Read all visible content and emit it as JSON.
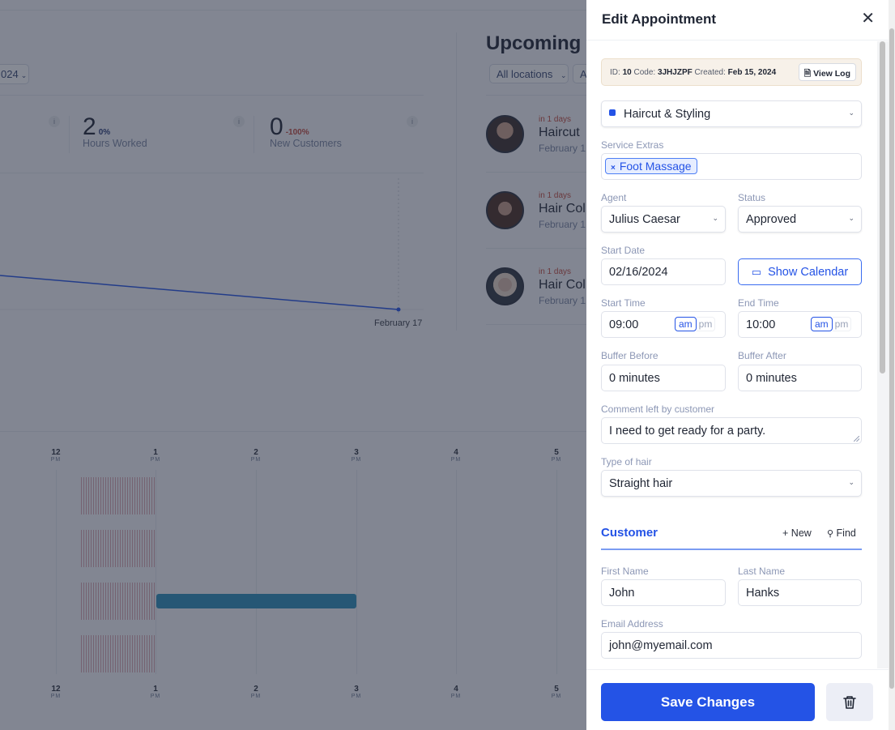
{
  "background": {
    "date_filter": "024",
    "stats": [
      {
        "value": "2",
        "change": "0%",
        "label": "Hours Worked"
      },
      {
        "value": "0",
        "change": "-100%",
        "label": "New Customers"
      }
    ],
    "chart_x_label": "February 17",
    "upcoming": {
      "title": "Upcoming",
      "filters": [
        "All locations",
        "Al"
      ],
      "items": [
        {
          "when": "in 1 days",
          "service": "Haircut",
          "date": "February 1"
        },
        {
          "when": "in 1 days",
          "service": "Hair Col",
          "date": "February 1"
        },
        {
          "when": "in 1 days",
          "service": "Hair Col",
          "date": "February 1"
        }
      ]
    },
    "timeline_ticks": [
      {
        "hour": "12",
        "ampm": "PM"
      },
      {
        "hour": "1",
        "ampm": "PM"
      },
      {
        "hour": "2",
        "ampm": "PM"
      },
      {
        "hour": "3",
        "ampm": "PM"
      },
      {
        "hour": "4",
        "ampm": "PM"
      },
      {
        "hour": "5",
        "ampm": "PM"
      }
    ]
  },
  "panel": {
    "title": "Edit Appointment",
    "meta": {
      "id_label": "ID:",
      "id": "10",
      "code_label": "Code:",
      "code": "3JHJZPF",
      "created_label": "Created:",
      "created": "Feb 15, 2024",
      "view_log": "View Log"
    },
    "service": {
      "value": "Haircut & Styling",
      "color": "#2453e6"
    },
    "service_extras": {
      "label": "Service Extras",
      "tags": [
        "Foot Massage"
      ]
    },
    "agent": {
      "label": "Agent",
      "value": "Julius Caesar"
    },
    "status": {
      "label": "Status",
      "value": "Approved"
    },
    "start_date": {
      "label": "Start Date",
      "value": "02/16/2024"
    },
    "show_calendar": "Show Calendar",
    "start_time": {
      "label": "Start Time",
      "value": "09:00",
      "am": "am",
      "pm": "pm",
      "selected": "am"
    },
    "end_time": {
      "label": "End Time",
      "value": "10:00",
      "am": "am",
      "pm": "pm",
      "selected": "am"
    },
    "buffer_before": {
      "label": "Buffer Before",
      "value": "0 minutes"
    },
    "buffer_after": {
      "label": "Buffer After",
      "value": "0 minutes"
    },
    "comment": {
      "label": "Comment left by customer",
      "value": "I need to get ready for a party."
    },
    "hair_type": {
      "label": "Type of hair",
      "value": "Straight hair"
    },
    "customer": {
      "title": "Customer",
      "new_label": "New",
      "find_label": "Find",
      "first_name": {
        "label": "First Name",
        "value": "John"
      },
      "last_name": {
        "label": "Last Name",
        "value": "Hanks"
      },
      "email": {
        "label": "Email Address",
        "value": "john@myemail.com"
      }
    },
    "save_label": "Save Changes"
  }
}
